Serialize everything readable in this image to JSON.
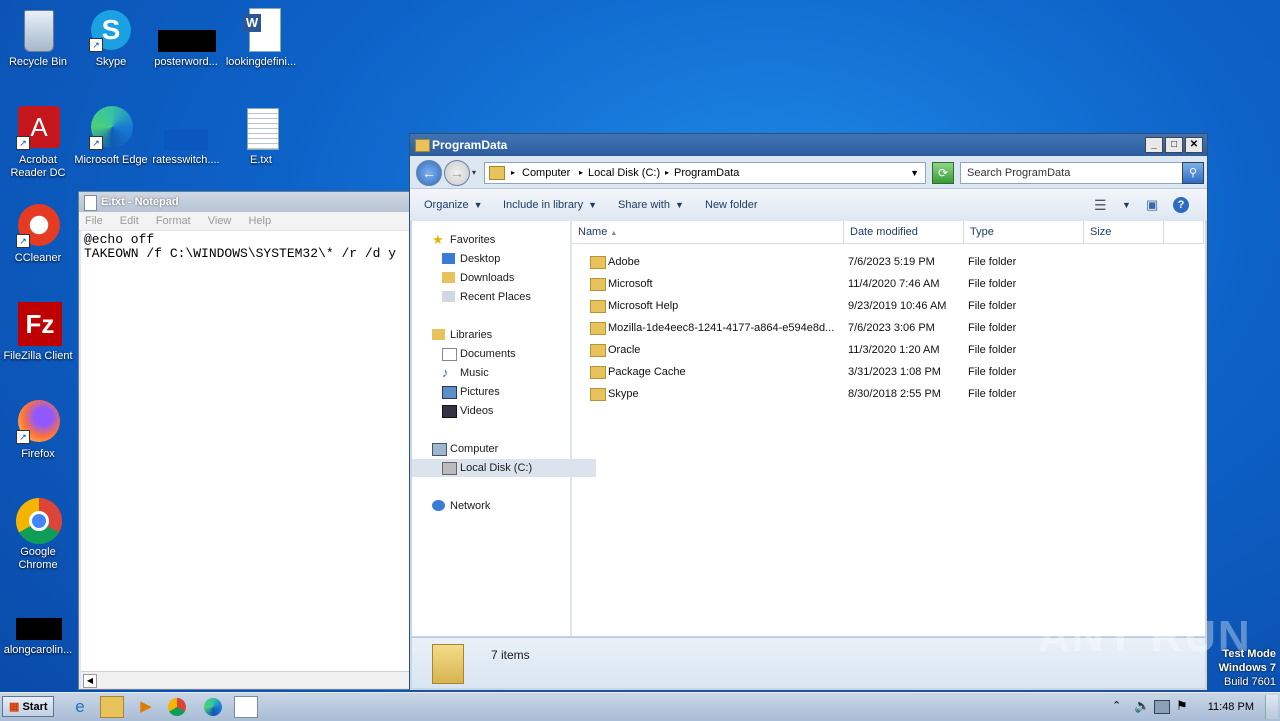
{
  "desktop": {
    "icons": [
      {
        "label": "Recycle Bin",
        "icon": "recycle-bin-icon"
      },
      {
        "label": "Skype",
        "icon": "skype-icon"
      },
      {
        "label": "posterword...",
        "icon": "redacted-file-icon"
      },
      {
        "label": "lookingdefini...",
        "icon": "word-doc-icon"
      },
      {
        "label": "Acrobat Reader DC",
        "icon": "acrobat-icon"
      },
      {
        "label": "Microsoft Edge",
        "icon": "edge-icon"
      },
      {
        "label": "ratesswitch....",
        "icon": "redacted-file-icon"
      },
      {
        "label": "E.txt",
        "icon": "text-file-icon"
      },
      {
        "label": "CCleaner",
        "icon": "ccleaner-icon"
      },
      {
        "label": "FileZilla Client",
        "icon": "filezilla-icon"
      },
      {
        "label": "Firefox",
        "icon": "firefox-icon"
      },
      {
        "label": "Google Chrome",
        "icon": "chrome-icon"
      },
      {
        "label": "alongcarolin...",
        "icon": "redacted-file-icon"
      }
    ]
  },
  "notepad": {
    "title": "E.txt - Notepad",
    "menu": [
      "File",
      "Edit",
      "Format",
      "View",
      "Help"
    ],
    "content": "@echo off\nTAKEOWN /f C:\\WINDOWS\\SYSTEM32\\* /r /d y"
  },
  "explorer": {
    "title": "ProgramData",
    "address": {
      "crumbs": [
        "Computer",
        "Local Disk (C:)",
        "ProgramData"
      ]
    },
    "search_placeholder": "Search ProgramData",
    "toolbar": {
      "organize": "Organize",
      "include": "Include in library",
      "share": "Share with",
      "new_folder": "New folder"
    },
    "nav": {
      "favorites": "Favorites",
      "desktop": "Desktop",
      "downloads": "Downloads",
      "recent": "Recent Places",
      "libraries": "Libraries",
      "documents": "Documents",
      "music": "Music",
      "pictures": "Pictures",
      "videos": "Videos",
      "computer": "Computer",
      "local_disk": "Local Disk (C:)",
      "network": "Network"
    },
    "columns": {
      "name": "Name",
      "date": "Date modified",
      "type": "Type",
      "size": "Size"
    },
    "rows": [
      {
        "name": "Adobe",
        "date": "7/6/2023 5:19 PM",
        "type": "File folder"
      },
      {
        "name": "Microsoft",
        "date": "11/4/2020 7:46 AM",
        "type": "File folder"
      },
      {
        "name": "Microsoft Help",
        "date": "9/23/2019 10:46 AM",
        "type": "File folder"
      },
      {
        "name": "Mozilla-1de4eec8-1241-4177-a864-e594e8d...",
        "date": "7/6/2023 3:06 PM",
        "type": "File folder"
      },
      {
        "name": "Oracle",
        "date": "11/3/2020 1:20 AM",
        "type": "File folder"
      },
      {
        "name": "Package Cache",
        "date": "3/31/2023 1:08 PM",
        "type": "File folder"
      },
      {
        "name": "Skype",
        "date": "8/30/2018 2:55 PM",
        "type": "File folder"
      }
    ],
    "status": "7 items"
  },
  "taskbar": {
    "start": "Start",
    "clock": "11:48 PM"
  },
  "watermark": {
    "line1": "Test Mode",
    "line2": "Windows 7",
    "line3": "Build 7601",
    "brand": "ANY RUN"
  }
}
